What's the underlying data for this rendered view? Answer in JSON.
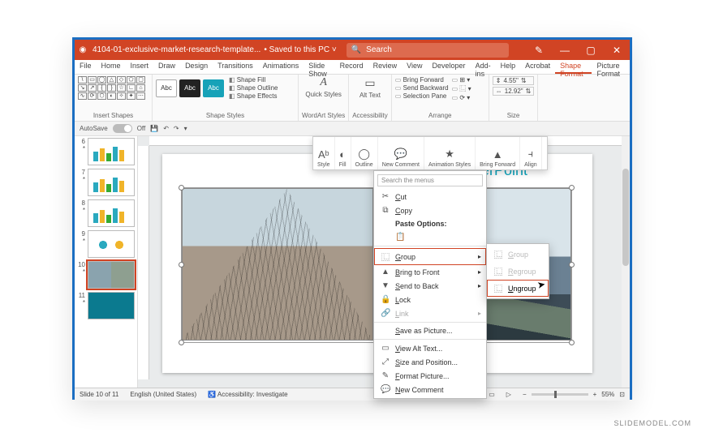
{
  "titlebar": {
    "filename": "4104-01-exclusive-market-research-template...",
    "save_state": "Saved to this PC ˅",
    "search_placeholder": "Search"
  },
  "tabs": [
    "File",
    "Home",
    "Insert",
    "Draw",
    "Design",
    "Transitions",
    "Animations",
    "Slide Show",
    "Record",
    "Review",
    "View",
    "Developer",
    "Add-ins",
    "Help",
    "Acrobat",
    "Shape Format",
    "Picture Format"
  ],
  "active_tabs": [
    "Shape Format"
  ],
  "ribbon": {
    "groups": {
      "insert_shapes": "Insert Shapes",
      "shape_styles": "Shape Styles",
      "wordart": "WordArt Styles",
      "accessibility": "Accessibility",
      "arrange": "Arrange",
      "size": "Size"
    },
    "style_swatches": [
      "Abc",
      "Abc",
      "Abc"
    ],
    "fill": "Shape Fill",
    "outline": "Shape Outline",
    "effects": "Shape Effects",
    "quick_styles": "Quick Styles",
    "alt_text": "Alt Text",
    "arrange_items": [
      "Bring Forward",
      "Send Backward",
      "Selection Pane"
    ],
    "size_h": "4.55\"",
    "size_w": "12.92\""
  },
  "autosave": {
    "label": "AutoSave",
    "state": "Off"
  },
  "float_toolbar": [
    "Style",
    "Fill",
    "Outline",
    "New Comment",
    "Animation Styles",
    "Bring Forward",
    "Align"
  ],
  "thumbnails": [
    {
      "n": "6",
      "cls": "bars"
    },
    {
      "n": "7",
      "cls": "bars"
    },
    {
      "n": "8",
      "cls": "bars"
    },
    {
      "n": "9",
      "cls": "diagram"
    },
    {
      "n": "10",
      "cls": "photos",
      "selected": true
    },
    {
      "n": "11",
      "cls": "teal"
    }
  ],
  "slide": {
    "title_fragment": "werPoint"
  },
  "context_menu": {
    "search_placeholder": "Search the menus",
    "items": [
      {
        "icon": "✂",
        "label": "Cut",
        "name": "cut"
      },
      {
        "icon": "⧉",
        "label": "Copy",
        "name": "copy"
      },
      {
        "icon": "",
        "label": "Paste Options:",
        "name": "paste-options",
        "bold": true
      },
      {
        "icon": "📋",
        "label": "",
        "name": "paste-picture",
        "indent": true
      },
      {
        "icon": "⿺",
        "label": "Group",
        "name": "group",
        "more": true,
        "hl": true
      },
      {
        "icon": "▲",
        "label": "Bring to Front",
        "name": "bring-to-front",
        "more": true
      },
      {
        "icon": "▼",
        "label": "Send to Back",
        "name": "send-to-back",
        "more": true
      },
      {
        "icon": "🔒",
        "label": "Lock",
        "name": "lock"
      },
      {
        "icon": "🔗",
        "label": "Link",
        "name": "link",
        "more": true,
        "disabled": true
      },
      {
        "icon": "",
        "label": "Save as Picture...",
        "name": "save-as-picture"
      },
      {
        "icon": "▭",
        "label": "View Alt Text...",
        "name": "view-alt-text"
      },
      {
        "icon": "⤢",
        "label": "Size and Position...",
        "name": "size-and-position"
      },
      {
        "icon": "✎",
        "label": "Format Picture...",
        "name": "format-picture"
      },
      {
        "icon": "💬",
        "label": "New Comment",
        "name": "new-comment"
      }
    ]
  },
  "group_submenu": [
    {
      "label": "Group",
      "name": "sub-group",
      "disabled": true
    },
    {
      "label": "Regroup",
      "name": "sub-regroup",
      "disabled": true
    },
    {
      "label": "Ungroup",
      "name": "sub-ungroup",
      "hl": true
    }
  ],
  "status": {
    "slide": "Slide 10 of 11",
    "lang": "English (United States)",
    "access": "Accessibility: Investigate",
    "zoom": "55%"
  },
  "watermark": "SLIDEMODEL.COM"
}
